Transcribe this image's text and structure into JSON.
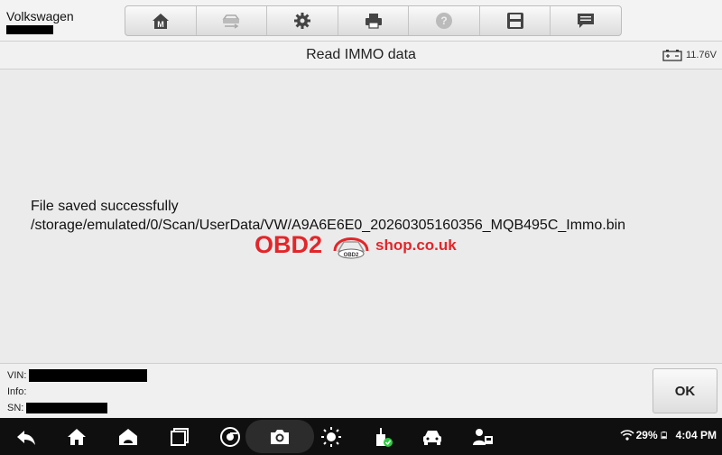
{
  "header": {
    "vehicle": "Volkswagen",
    "toolbar_buttons": [
      {
        "name": "home",
        "icon": "m-home-icon"
      },
      {
        "name": "vehicle-swap",
        "icon": "car-swap-icon"
      },
      {
        "name": "settings",
        "icon": "gear-icon"
      },
      {
        "name": "print",
        "icon": "printer-icon"
      },
      {
        "name": "help",
        "icon": "help-icon"
      },
      {
        "name": "save",
        "icon": "floppy-icon"
      },
      {
        "name": "feedback",
        "icon": "message-icon"
      }
    ]
  },
  "titlebar": {
    "title": "Read IMMO data",
    "voltage": "11.76V"
  },
  "content": {
    "line1": "File saved successfully",
    "line2": "/storage/emulated/0/Scan/UserData/VW/A9A6E6E0_20260305160356_MQB495C_Immo.bin",
    "watermark": {
      "brand": "OBD2",
      "suffix": "shop.co.uk",
      "car_badge": "OBD2"
    }
  },
  "footer": {
    "vin_label": "VIN:",
    "info_label": "Info:",
    "sn_label": "SN:",
    "ok_label": "OK"
  },
  "system_bar": {
    "battery_percent": "29%",
    "time": "4:04 PM"
  },
  "colors": {
    "watermark": "#e2262a",
    "system_bar": "#0f0f0f",
    "background": "#ebebeb"
  }
}
